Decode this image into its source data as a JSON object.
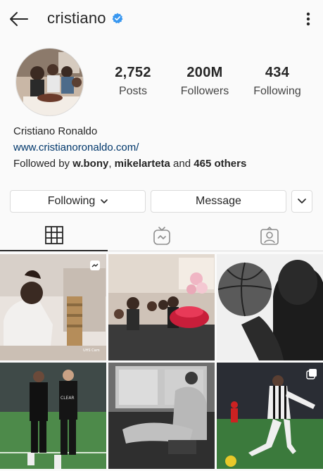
{
  "header": {
    "username": "cristiano",
    "verified": true,
    "back_icon": "arrow-left-icon",
    "menu_icon": "kebab-menu-icon"
  },
  "stats": {
    "posts_count": "2,752",
    "posts_label": "Posts",
    "followers_count": "200M",
    "followers_label": "Followers",
    "following_count": "434",
    "following_label": "Following"
  },
  "bio": {
    "full_name": "Cristiano Ronaldo",
    "website": "www.cristianoronaldo.com/",
    "followed_prefix": "Followed by ",
    "followed_user1": "w.bony",
    "followed_sep": ", ",
    "followed_user2": "mikelarteta",
    "followed_and": " and ",
    "followed_others": "465 others"
  },
  "actions": {
    "following_label": "Following",
    "message_label": "Message",
    "more_icon": "chevron-down-icon"
  },
  "tabs": [
    {
      "icon": "grid-icon",
      "active": true
    },
    {
      "icon": "igtv-icon",
      "active": false
    },
    {
      "icon": "tagged-icon",
      "active": false
    }
  ],
  "posts": [
    {
      "type": "igtv",
      "caption_overlay": "UHS Cam"
    },
    {
      "type": "photo"
    },
    {
      "type": "photo"
    },
    {
      "type": "photo"
    },
    {
      "type": "photo"
    },
    {
      "type": "carousel"
    }
  ],
  "colors": {
    "link": "#00376b",
    "verified": "#3897f0",
    "border": "#dbdbdb",
    "background": "#fafafa"
  }
}
